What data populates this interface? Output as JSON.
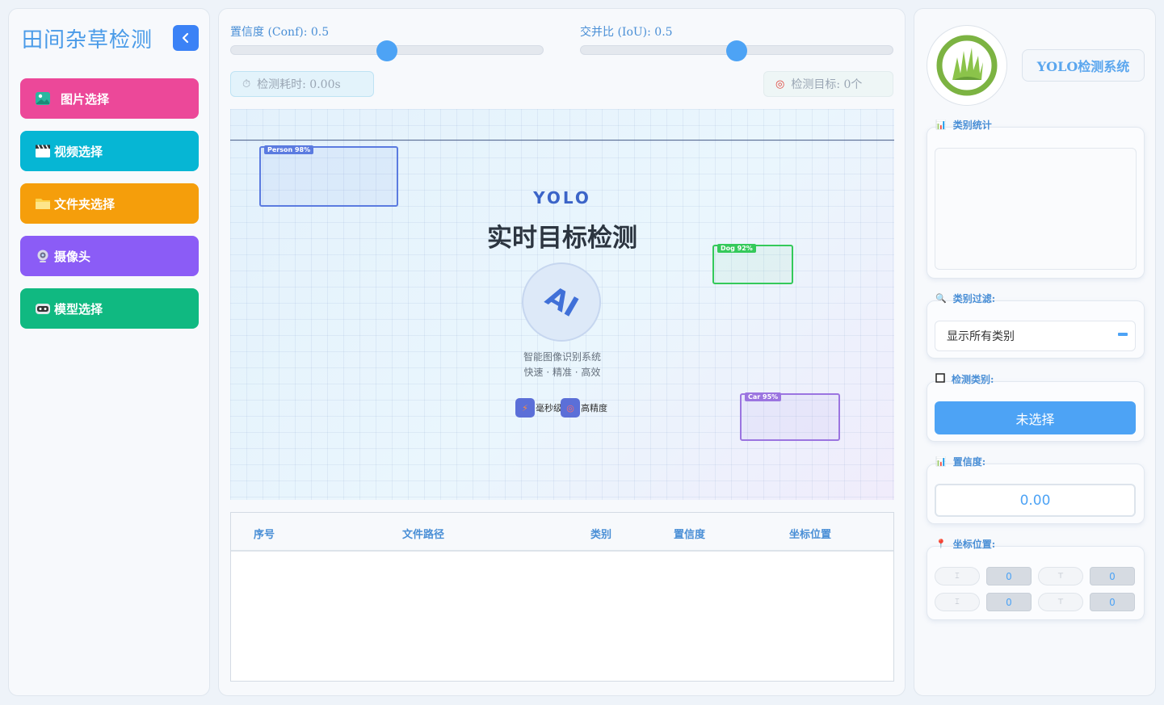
{
  "sidebar": {
    "title": "田间杂草检测",
    "buttons": {
      "image": "图片选择",
      "video": "视频选择",
      "folder": "文件夹选择",
      "camera": "摄像头",
      "model": "模型选择"
    }
  },
  "controls": {
    "conf_label": "置信度 (Conf): 0.5",
    "conf_value": 0.5,
    "iou_label": "交并比 (IoU): 0.5",
    "iou_value": 0.5,
    "time_label": "检测耗时: 0.00s",
    "count_label": "检测目标: 0个"
  },
  "canvas": {
    "yolo": "YOLO",
    "title": "实时目标检测",
    "ai": "AI",
    "sub1": "智能图像识别系统",
    "sub2": "快速 · 精准 · 高效",
    "feature1": "毫秒级",
    "feature2": "高精度",
    "boxes": [
      {
        "label": "Person 98%",
        "color": "#5b7be0"
      },
      {
        "label": "Dog 92%",
        "color": "#34c95a"
      },
      {
        "label": "Car 95%",
        "color": "#9b74e0"
      }
    ]
  },
  "table": {
    "headers": [
      "序号",
      "文件路径",
      "类别",
      "置信度",
      "坐标位置"
    ],
    "rows": []
  },
  "right": {
    "system_title": "YOLO检测系统",
    "stats_label": "类别统计",
    "filter_label": "类别过滤:",
    "filter_value": "显示所有类别",
    "class_label": "检测类别:",
    "class_value": "未选择",
    "conf_label": "置信度:",
    "conf_value": "0.00",
    "coord_label": "坐标位置:",
    "coords": {
      "xmin": "0",
      "ymin": "0",
      "xmax": "0",
      "ymax": "0"
    }
  },
  "colors": {
    "accent": "#4da3f5",
    "image_btn": "#ec4899",
    "video_btn": "#06b6d4",
    "folder_btn": "#f59e0b",
    "camera_btn": "#8b5cf6",
    "model_btn": "#10b981"
  }
}
